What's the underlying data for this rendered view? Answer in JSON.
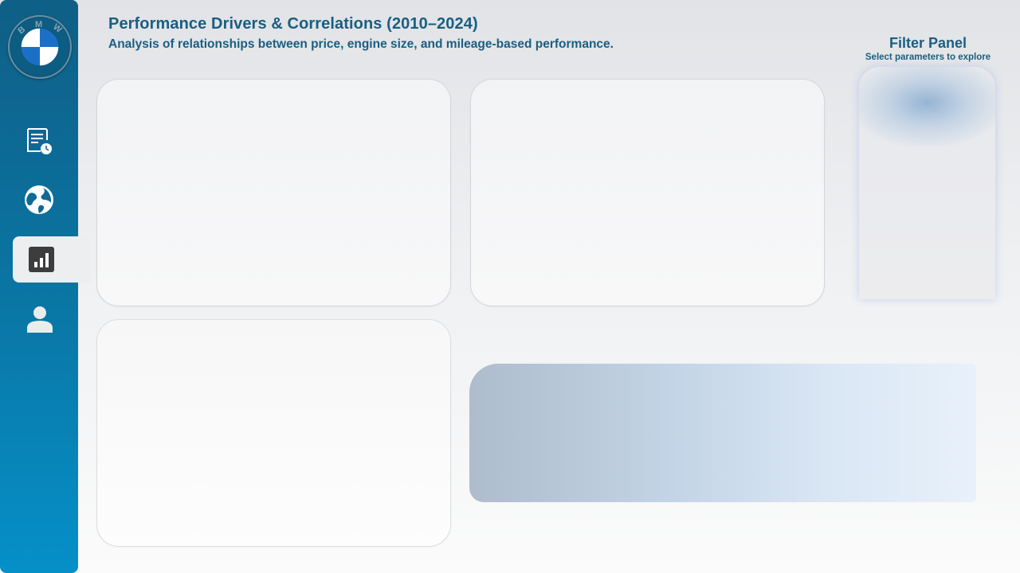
{
  "header": {
    "title": "Performance Drivers & Correlations (2010–2024)",
    "subtitle": "Analysis of relationships between price, engine size, and mileage-based performance."
  },
  "logo": {
    "brand": "BMW",
    "letters": [
      "B",
      "M",
      "W"
    ]
  },
  "sidebar": {
    "items": [
      {
        "icon": "report-clock-icon",
        "active": false
      },
      {
        "icon": "globe-icon",
        "active": false
      },
      {
        "icon": "bar-chart-icon",
        "active": true
      },
      {
        "icon": "user-icon",
        "active": false
      }
    ]
  },
  "filter": {
    "title": "Filter Panel",
    "subtitle": "Select parameters to explore"
  },
  "colors": {
    "sidebar_top": "#0f5f86",
    "sidebar_bottom": "#0590c8",
    "heading": "#1a5e82",
    "bmw_blue": "#1c6fc7"
  }
}
